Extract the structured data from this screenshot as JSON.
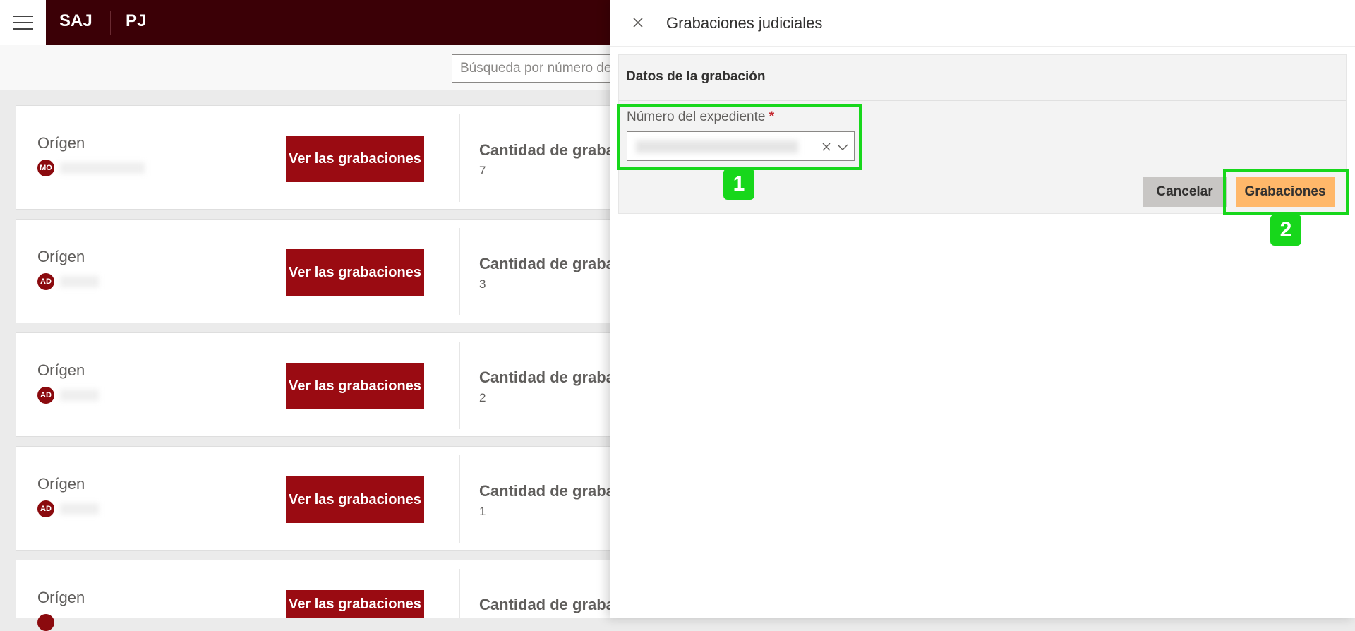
{
  "topbar": {
    "brand_primary": "SAJ",
    "brand_secondary": "PJ"
  },
  "search": {
    "placeholder": "Búsqueda por número de expediente"
  },
  "cards": [
    {
      "origin_label": "Orígen",
      "avatar": "MO",
      "button_label": "Ver las grabaciones",
      "count_label": "Cantidad de grabaciones",
      "count": "7"
    },
    {
      "origin_label": "Orígen",
      "avatar": "AD",
      "button_label": "Ver las grabaciones",
      "count_label": "Cantidad de grabaciones",
      "count": "3"
    },
    {
      "origin_label": "Orígen",
      "avatar": "AD",
      "button_label": "Ver las grabaciones",
      "count_label": "Cantidad de grabaciones",
      "count": "2"
    },
    {
      "origin_label": "Orígen",
      "avatar": "AD",
      "button_label": "Ver las grabaciones",
      "count_label": "Cantidad de grabaciones",
      "count": "1"
    },
    {
      "origin_label": "Orígen",
      "avatar": "",
      "button_label": "Ver las grabaciones",
      "count_label": "Cantidad de grabaciones",
      "count": ""
    }
  ],
  "panel": {
    "title": "Grabaciones judiciales",
    "section_title": "Datos de la grabación",
    "field_label": "Número del expediente",
    "required_mark": "*",
    "cancel_label": "Cancelar",
    "submit_label": "Grabaciones"
  },
  "annotations": {
    "badge_1": "1",
    "badge_2": "2"
  },
  "colors": {
    "topbar": "#3b0006",
    "button": "#9a0b12",
    "primary": "#ffb86a",
    "highlight": "#17d71b"
  }
}
